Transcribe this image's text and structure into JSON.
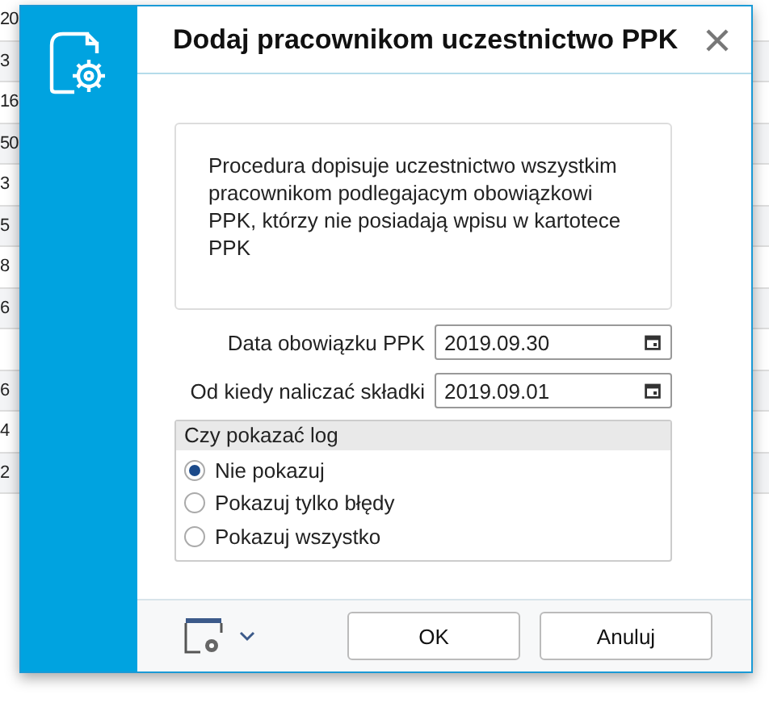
{
  "background_table": {
    "rows": [
      {
        "column_1": "20"
      },
      {
        "column_1": "3"
      },
      {
        "column_1": "16"
      },
      {
        "column_1": "50"
      },
      {
        "column_1": "3"
      },
      {
        "column_1": "5"
      },
      {
        "column_1": "8"
      },
      {
        "column_1": "6"
      },
      {
        "column_1": ""
      },
      {
        "column_1": "6"
      },
      {
        "column_1": "4"
      },
      {
        "column_1": "2"
      }
    ]
  },
  "dialog": {
    "title": "Dodaj pracownikom uczestnictwo PPK",
    "description": "Procedura dopisuje uczestnictwo wszystkim pracownikom podlegajacym obowiązkowi PPK, którzy nie posiadają wpisu w kartotece PPK",
    "fields": [
      {
        "label": "Data obowiązku PPK",
        "value": "2019.09.30"
      },
      {
        "label": "Od kiedy naliczać składki",
        "value": "2019.09.01"
      }
    ],
    "log_group": {
      "title": "Czy pokazać log",
      "options": [
        {
          "label": "Nie pokazuj",
          "selected": true
        },
        {
          "label": "Pokazuj tylko błędy",
          "selected": false
        },
        {
          "label": "Pokazuj wszystko",
          "selected": false
        }
      ]
    },
    "buttons": [
      "OK",
      "Anuluj"
    ]
  }
}
